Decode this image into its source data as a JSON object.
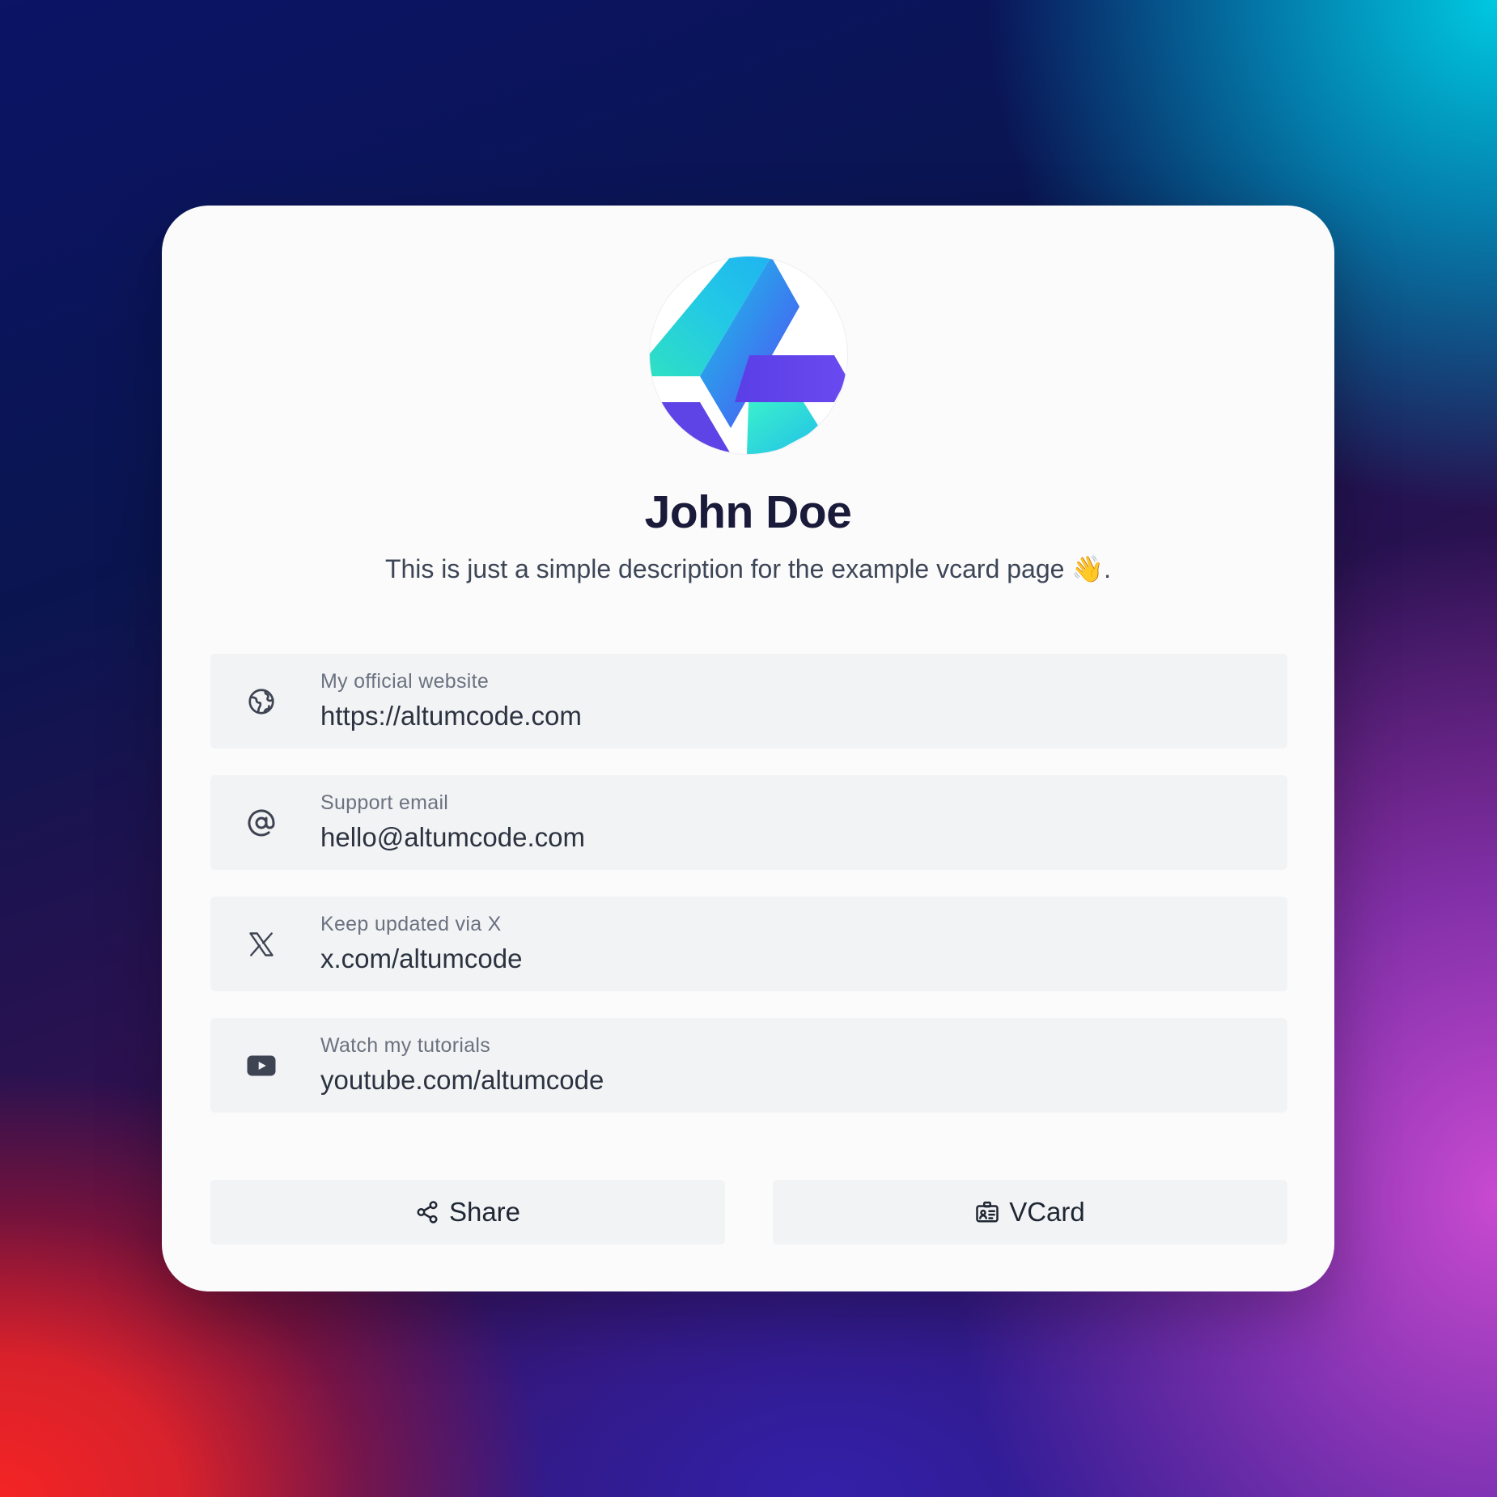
{
  "profile": {
    "name": "John Doe",
    "description": "This is just a simple description for the example vcard page 👋."
  },
  "links": [
    {
      "icon": "globe-icon",
      "label": "My official website",
      "value": "https://altumcode.com"
    },
    {
      "icon": "at-sign-icon",
      "label": "Support email",
      "value": "hello@altumcode.com"
    },
    {
      "icon": "x-logo-icon",
      "label": "Keep updated via X",
      "value": "x.com/altumcode"
    },
    {
      "icon": "youtube-icon",
      "label": "Watch my tutorials",
      "value": "youtube.com/altumcode"
    }
  ],
  "actions": {
    "share_label": "Share",
    "share_icon": "share-icon",
    "vcard_label": "VCard",
    "vcard_icon": "id-card-icon"
  },
  "colors": {
    "card": "#fbfbfc",
    "row": "#f2f3f5",
    "name": "#1a1a3a",
    "text": "#3d4656"
  }
}
